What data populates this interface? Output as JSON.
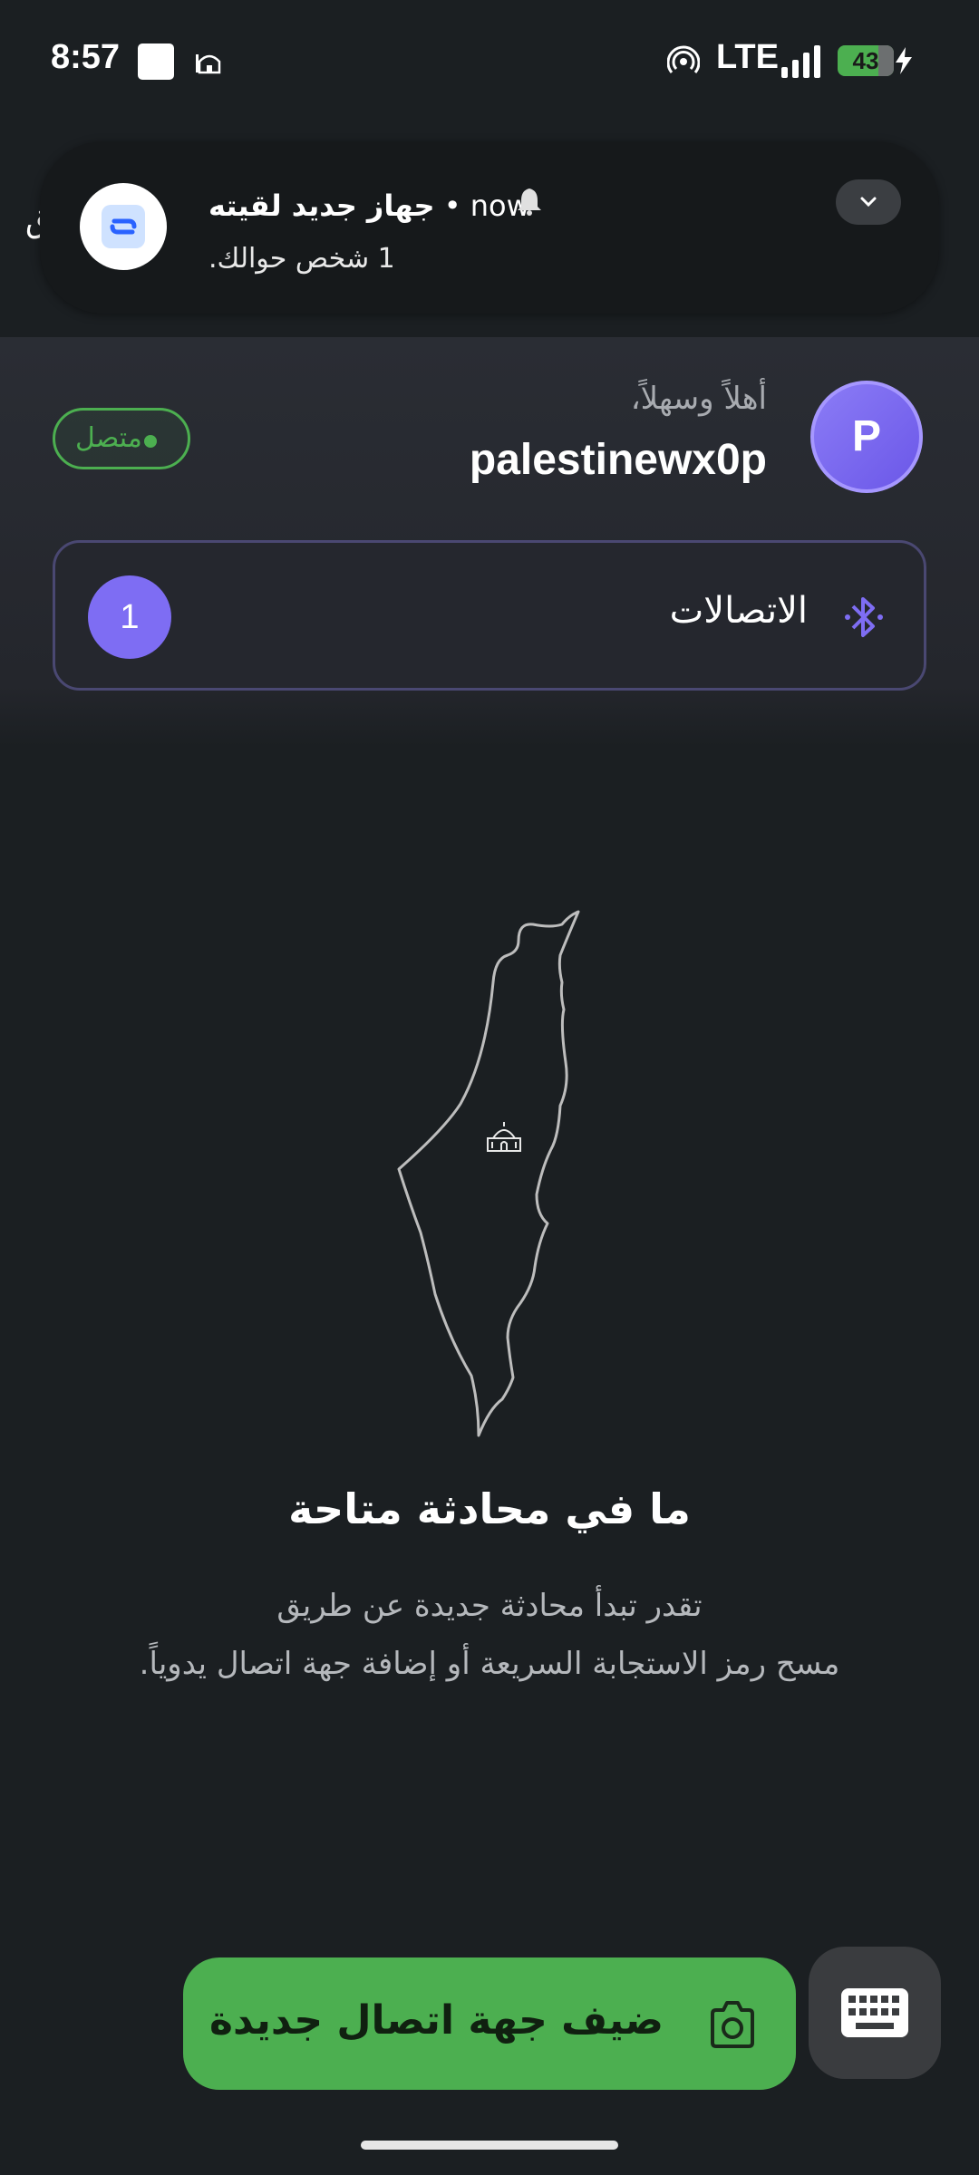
{
  "status_bar": {
    "time": "8:57",
    "network": "LTE",
    "battery": "43",
    "icons": [
      "app-square-icon",
      "mosque-icon",
      "hotspot-icon",
      "signal-icon",
      "battery-icon",
      "charging-bolt-icon"
    ]
  },
  "notification": {
    "app_icon": "link-app-icon",
    "title": "جهاز جديد لقيته",
    "time": "now",
    "text": "1 شخص حوالك.",
    "bell_icon": "bell-icon",
    "expand_icon": "chevron-down-icon",
    "edge_glyph": "ق"
  },
  "header": {
    "avatar_letter": "P",
    "greeting": "أهلاً وسهلاً،",
    "username": "palestinewx0p",
    "status": "متصل",
    "connections_label": "الاتصالات",
    "connections_count": "1",
    "accent_color": "#7e6df3",
    "status_color": "#4caf50"
  },
  "empty_state": {
    "illustration": "palestine-map-with-dome-icon",
    "title": "ما في محادثة متاحة",
    "line1": "تقدر تبدأ محادثة جديدة عن طريق",
    "line2": "مسح رمز الاستجابة السريعة أو إضافة جهة اتصال يدوياً."
  },
  "actions": {
    "add_contact_label": "ضيف جهة اتصال جديدة",
    "add_icon": "camera-icon",
    "keyboard_icon": "keyboard-icon",
    "button_color": "#4caf50"
  }
}
